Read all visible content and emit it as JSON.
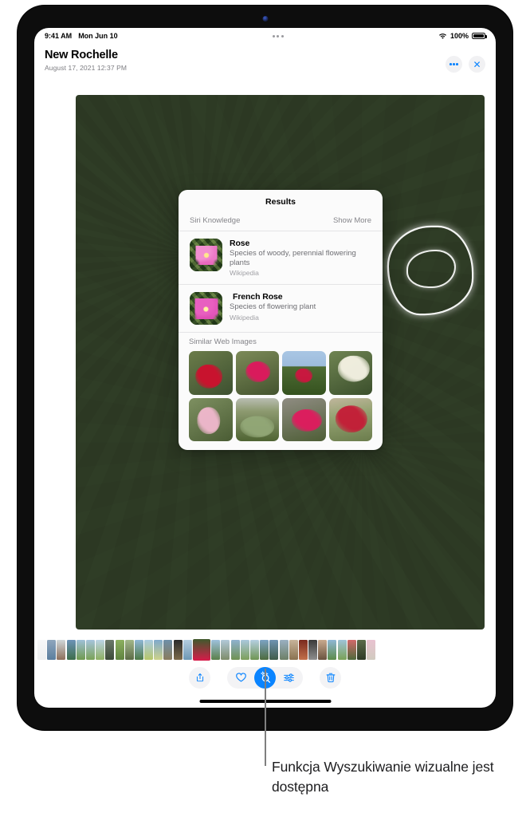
{
  "statusbar": {
    "time": "9:41 AM",
    "date": "Mon Jun 10",
    "wifi_icon": "wifi-icon",
    "battery_percent": "100%",
    "battery_icon": "battery-full-icon",
    "multitask_icon": "multitasking-dots-icon"
  },
  "header": {
    "title": "New Rochelle",
    "subtitle": "August 17, 2021  12:37 PM",
    "more_icon": "more-dots-icon",
    "close_icon": "close-x-icon",
    "accent_color": "#0a84ff"
  },
  "photo": {
    "name": "rose-bush-photo",
    "subject_highlight": "visual-lookup-subject-outline"
  },
  "results_popup": {
    "title": "Results",
    "section_label": "Siri Knowledge",
    "show_more_label": "Show More",
    "knowledge_items": [
      {
        "name": "Rose",
        "description": "Species of woody, perennial flowering plants",
        "source": "Wikipedia",
        "thumb_icon": "pink-rose-thumbnail"
      },
      {
        "name": "French Rose",
        "description": "Species of flowering plant",
        "source": "Wikipedia",
        "thumb_icon": "magenta-rose-thumbnail"
      }
    ],
    "similar_label": "Similar Web Images",
    "similar_images": [
      {
        "name": "red-rose-closeup",
        "bg": "linear-gradient(150deg,#6b7c4a,#3d5030)",
        "bloom": "#cf0f2e",
        "bx": "46%",
        "by": "58%",
        "bw": "62%",
        "bh": "56%"
      },
      {
        "name": "pink-rose-bush",
        "bg": "linear-gradient(160deg,#7c8a58,#44542f)",
        "bloom": "#e0175e",
        "bx": "52%",
        "by": "48%",
        "bw": "58%",
        "bh": "48%"
      },
      {
        "name": "rose-with-sky",
        "bg": "linear-gradient(180deg,#a9c6e4 0%,#9dbcdc 34%,#4d6b33 36%,#35521f 100%)",
        "bloom": "#cf1440",
        "bx": "50%",
        "by": "56%",
        "bw": "40%",
        "bh": "34%"
      },
      {
        "name": "white-roses",
        "bg": "linear-gradient(155deg,#6f8452,#3b4f2c)",
        "bloom": "#f7f4e6",
        "bx": "58%",
        "by": "40%",
        "bw": "74%",
        "bh": "60%"
      },
      {
        "name": "light-pink-roses",
        "bg": "linear-gradient(150deg,#7e9061,#4a5c34)",
        "bloom": "#f2b9cf",
        "bx": "46%",
        "by": "52%",
        "bw": "54%",
        "bh": "62%"
      },
      {
        "name": "rose-garden-row",
        "bg": "linear-gradient(180deg,#b9bdb2 0%,#8d9a70 30%,#4f6433 100%)",
        "bloom": "#93a878",
        "bx": "50%",
        "by": "66%",
        "bw": "80%",
        "bh": "50%"
      },
      {
        "name": "deep-pink-rose-pair",
        "bg": "linear-gradient(165deg,#8f8c82,#4e5e36)",
        "bloom": "#e11a5e",
        "bx": "56%",
        "by": "52%",
        "bw": "70%",
        "bh": "52%"
      },
      {
        "name": "rose-shrub-with-label",
        "bg": "linear-gradient(170deg,#c0b69c 0%,#93a271 40%,#6b7c4c 100%)",
        "bloom": "#c51b36",
        "bx": "52%",
        "by": "48%",
        "bw": "74%",
        "bh": "62%"
      }
    ]
  },
  "filmstrip": {
    "name": "photo-filmstrip",
    "thumbs": [
      {
        "bg": "linear-gradient(180deg,#e9eaec,#cfd3d6)",
        "edge": true
      },
      {
        "bg": "linear-gradient(180deg,#8fa6bd,#5b7e9e)"
      },
      {
        "bg": "linear-gradient(180deg,#cfd6d9,#8d6f5c)"
      },
      {
        "bg": "linear-gradient(180deg,#6d93b8,#3c6d4a)"
      },
      {
        "bg": "linear-gradient(180deg,#9fc0d8,#6f9a4f)"
      },
      {
        "bg": "linear-gradient(180deg,#a6c4dd,#7aa257)"
      },
      {
        "bg": "linear-gradient(180deg,#bcd4e6,#8eb063)"
      },
      {
        "bg": "linear-gradient(180deg,#6c7a6a,#3c4a38)"
      },
      {
        "bg": "linear-gradient(180deg,#8db05f,#5f8340)"
      },
      {
        "bg": "linear-gradient(180deg,#a2b78a,#5c6b46)"
      },
      {
        "bg": "linear-gradient(180deg,#8fb7d6,#4e7a46)"
      },
      {
        "bg": "linear-gradient(180deg,#a9cbe2,#b7c76a)"
      },
      {
        "bg": "linear-gradient(180deg,#7fa9cc,#cdd28a)"
      },
      {
        "bg": "linear-gradient(180deg,#6d8fa8,#8a7c5e)"
      },
      {
        "bg": "linear-gradient(180deg,#2b2b2b,#7c6a4a)"
      },
      {
        "bg": "linear-gradient(180deg,#b4cde0,#6e98b4)"
      },
      {
        "bg": "linear-gradient(180deg,#3f5a2c,#d81b4a)",
        "current": true
      },
      {
        "bg": "linear-gradient(180deg,#9ec1dd,#5a7f4a)"
      },
      {
        "bg": "linear-gradient(180deg,#b2c9d9,#7e8c6a)"
      },
      {
        "bg": "linear-gradient(180deg,#8fb2cf,#6f9153)"
      },
      {
        "bg": "linear-gradient(180deg,#aac8dd,#7d9f5b)"
      },
      {
        "bg": "linear-gradient(180deg,#b5cfe2,#6f9553)"
      },
      {
        "bg": "linear-gradient(180deg,#7ca3c4,#4d6b3e)"
      },
      {
        "bg": "linear-gradient(180deg,#6f93b2,#3f5c4a)"
      },
      {
        "bg": "linear-gradient(180deg,#9ab0c2,#6d7f66)"
      },
      {
        "bg": "linear-gradient(180deg,#c7b39a,#8a7250)"
      },
      {
        "bg": "linear-gradient(180deg,#7a2a1e,#c2704a)"
      },
      {
        "bg": "linear-gradient(180deg,#3a3a3a,#8e8e8e)"
      },
      {
        "bg": "linear-gradient(180deg,#c8a98e,#6a5340)"
      },
      {
        "bg": "linear-gradient(180deg,#8fb7d6,#5c8c4a)"
      },
      {
        "bg": "linear-gradient(180deg,#9fc3d8,#7aa257)"
      },
      {
        "bg": "linear-gradient(180deg,#d2696a,#4e6a3c)"
      },
      {
        "bg": "linear-gradient(180deg,#5b6b4a,#2e3a26)"
      },
      {
        "bg": "linear-gradient(180deg,#c0507a,#7a6a4a)",
        "edge": true
      }
    ]
  },
  "toolbar": {
    "share_icon": "share-icon",
    "favorite_icon": "heart-icon",
    "visual_lookup_icon": "visual-lookup-sparkle-icon",
    "adjust_icon": "adjust-sliders-icon",
    "delete_icon": "trash-icon",
    "active_button": "visual-lookup-sparkle-icon",
    "active_color": "#0a84ff"
  },
  "callout": {
    "caption": "Funkcja Wyszukiwanie wizualne jest dostępna",
    "line_color": "#7f7f7f"
  }
}
